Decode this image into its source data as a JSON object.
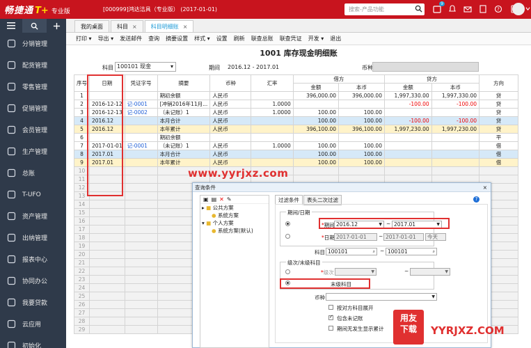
{
  "header": {
    "brand": "畅捷通",
    "brand_plus": "T+",
    "edition": "专业版",
    "company": "[000999]鸿达洁具（专业版） (2017-01-01)",
    "search_placeholder": "搜索-产品功能",
    "notification_count": "9"
  },
  "sidebar": {
    "items": [
      {
        "label": "分销管理",
        "icon": "distribution-icon"
      },
      {
        "label": "配货管理",
        "icon": "truck-icon"
      },
      {
        "label": "零售管理",
        "icon": "cart-icon"
      },
      {
        "label": "促销管理",
        "icon": "megaphone-icon"
      },
      {
        "label": "会员管理",
        "icon": "member-icon"
      },
      {
        "label": "生产管理",
        "icon": "gear-icon"
      },
      {
        "label": "总账",
        "icon": "ledger-icon"
      },
      {
        "label": "T-UFO",
        "icon": "report-icon"
      },
      {
        "label": "资产管理",
        "icon": "assets-icon"
      },
      {
        "label": "出纳管理",
        "icon": "cashier-icon"
      },
      {
        "label": "报表中心",
        "icon": "chart-icon"
      },
      {
        "label": "协同办公",
        "icon": "collab-icon"
      },
      {
        "label": "我要贷款",
        "icon": "loan-icon"
      },
      {
        "label": "云应用",
        "icon": "cloud-icon"
      },
      {
        "label": "初始化",
        "icon": "init-icon"
      }
    ]
  },
  "tabs": [
    {
      "label": "我的桌面",
      "closable": false,
      "active": false
    },
    {
      "label": "科目",
      "closable": true,
      "active": false
    },
    {
      "label": "科目明细账",
      "closable": true,
      "active": true
    }
  ],
  "toolbar": [
    "打印",
    "导出",
    "发送邮件",
    "查询",
    "摘要设置",
    "样式",
    "设置",
    "刷新",
    "联查总账",
    "联查凭证",
    "开发",
    "退出"
  ],
  "report": {
    "title": "1001  库存现金明细账",
    "subject_label": "科目",
    "subject_value": "100101 现金",
    "period_label": "期间",
    "period_value": "2016.12 - 2017.01",
    "currency_label": "币种"
  },
  "grid": {
    "headers": {
      "row_no": "序号",
      "date": "日期",
      "voucher": "凭证字号",
      "summary": "摘要",
      "currency": "币种",
      "rate": "汇率",
      "debit": "借方",
      "credit": "贷方",
      "direction": "方向",
      "amount": "金额",
      "base": "本币"
    },
    "rows": [
      {
        "no": "1",
        "date": "",
        "voucher": "",
        "summary": "期初余额",
        "currency": "人民币",
        "rate": "",
        "d_amt": "396,000.00",
        "d_base": "396,000.00",
        "c_amt": "1,997,330.00",
        "c_base": "1,997,330.00",
        "dir": "贷",
        "style": ""
      },
      {
        "no": "2",
        "date": "2016-12-12",
        "voucher": "记-0001",
        "summary": "[冲销2016年11月...",
        "currency": "人民币",
        "rate": "1.0000",
        "d_amt": "",
        "d_base": "",
        "c_amt": "-100.00",
        "c_base": "-100.00",
        "dir": "贷",
        "style": ""
      },
      {
        "no": "3",
        "date": "2016-12-13",
        "voucher": "记-0002",
        "summary": "（未记账）1",
        "currency": "人民币",
        "rate": "1.0000",
        "d_amt": "100.00",
        "d_base": "100.00",
        "c_amt": "",
        "c_base": "",
        "dir": "贷",
        "style": ""
      },
      {
        "no": "4",
        "date": "2016.12",
        "voucher": "",
        "summary": "本月合计",
        "currency": "人民币",
        "rate": "",
        "d_amt": "100.00",
        "d_base": "100.00",
        "c_amt": "-100.00",
        "c_base": "-100.00",
        "dir": "贷",
        "style": "blue-row"
      },
      {
        "no": "5",
        "date": "2016.12",
        "voucher": "",
        "summary": "本年累计",
        "currency": "人民币",
        "rate": "",
        "d_amt": "396,100.00",
        "d_base": "396,100.00",
        "c_amt": "1,997,230.00",
        "c_base": "1,997,230.00",
        "dir": "贷",
        "style": "yel-row"
      },
      {
        "no": "6",
        "date": "",
        "voucher": "",
        "summary": "期初余额",
        "currency": "",
        "rate": "",
        "d_amt": "",
        "d_base": "",
        "c_amt": "",
        "c_base": "",
        "dir": "平",
        "style": ""
      },
      {
        "no": "7",
        "date": "2017-01-01",
        "voucher": "记-0001",
        "summary": "（未记账）1",
        "currency": "人民币",
        "rate": "1.0000",
        "d_amt": "100.00",
        "d_base": "100.00",
        "c_amt": "",
        "c_base": "",
        "dir": "借",
        "style": ""
      },
      {
        "no": "8",
        "date": "2017.01",
        "voucher": "",
        "summary": "本月合计",
        "currency": "人民币",
        "rate": "",
        "d_amt": "100.00",
        "d_base": "100.00",
        "c_amt": "",
        "c_base": "",
        "dir": "借",
        "style": "blue-row"
      },
      {
        "no": "9",
        "date": "2017.01",
        "voucher": "",
        "summary": "本年累计",
        "currency": "人民币",
        "rate": "",
        "d_amt": "100.00",
        "d_base": "100.00",
        "c_amt": "",
        "c_base": "",
        "dir": "借",
        "style": "yel-row"
      },
      {
        "no": "10",
        "date": "",
        "voucher": "",
        "summary": "",
        "currency": "",
        "rate": "",
        "d_amt": "",
        "d_base": "",
        "c_amt": "",
        "c_base": "",
        "dir": "",
        "style": "gray-row"
      },
      {
        "no": "11",
        "date": "",
        "voucher": "",
        "summary": "",
        "currency": "",
        "rate": "",
        "d_amt": "",
        "d_base": "",
        "c_amt": "",
        "c_base": "",
        "dir": "",
        "style": "gray-row"
      },
      {
        "no": "12",
        "date": "",
        "voucher": "",
        "summary": "",
        "currency": "",
        "rate": "",
        "d_amt": "",
        "d_base": "",
        "c_amt": "",
        "c_base": "",
        "dir": "",
        "style": "gray-row"
      },
      {
        "no": "13",
        "date": "",
        "voucher": "",
        "summary": "",
        "currency": "",
        "rate": "",
        "d_amt": "",
        "d_base": "",
        "c_amt": "",
        "c_base": "",
        "dir": "",
        "style": "gray-row"
      },
      {
        "no": "14",
        "date": "",
        "voucher": "",
        "summary": "",
        "currency": "",
        "rate": "",
        "d_amt": "",
        "d_base": "",
        "c_amt": "",
        "c_base": "",
        "dir": "",
        "style": "gray-row"
      },
      {
        "no": "15",
        "date": "",
        "voucher": "",
        "summary": "",
        "currency": "",
        "rate": "",
        "d_amt": "",
        "d_base": "",
        "c_amt": "",
        "c_base": "",
        "dir": "",
        "style": "gray-row"
      },
      {
        "no": "16",
        "date": "",
        "voucher": "",
        "summary": "",
        "currency": "",
        "rate": "",
        "d_amt": "",
        "d_base": "",
        "c_amt": "",
        "c_base": "",
        "dir": "",
        "style": "gray-row"
      },
      {
        "no": "17",
        "date": "",
        "voucher": "",
        "summary": "",
        "currency": "",
        "rate": "",
        "d_amt": "",
        "d_base": "",
        "c_amt": "",
        "c_base": "",
        "dir": "",
        "style": "gray-row"
      },
      {
        "no": "18",
        "date": "",
        "voucher": "",
        "summary": "",
        "currency": "",
        "rate": "",
        "d_amt": "",
        "d_base": "",
        "c_amt": "",
        "c_base": "",
        "dir": "",
        "style": "gray-row"
      },
      {
        "no": "19",
        "date": "",
        "voucher": "",
        "summary": "",
        "currency": "",
        "rate": "",
        "d_amt": "",
        "d_base": "",
        "c_amt": "",
        "c_base": "",
        "dir": "",
        "style": "gray-row"
      },
      {
        "no": "20",
        "date": "",
        "voucher": "",
        "summary": "",
        "currency": "",
        "rate": "",
        "d_amt": "",
        "d_base": "",
        "c_amt": "",
        "c_base": "",
        "dir": "",
        "style": "gray-row"
      },
      {
        "no": "21",
        "date": "",
        "voucher": "",
        "summary": "",
        "currency": "",
        "rate": "",
        "d_amt": "",
        "d_base": "",
        "c_amt": "",
        "c_base": "",
        "dir": "",
        "style": "gray-row"
      },
      {
        "no": "22",
        "date": "",
        "voucher": "",
        "summary": "",
        "currency": "",
        "rate": "",
        "d_amt": "",
        "d_base": "",
        "c_amt": "",
        "c_base": "",
        "dir": "",
        "style": "gray-row"
      },
      {
        "no": "23",
        "date": "",
        "voucher": "",
        "summary": "",
        "currency": "",
        "rate": "",
        "d_amt": "",
        "d_base": "",
        "c_amt": "",
        "c_base": "",
        "dir": "",
        "style": "gray-row"
      },
      {
        "no": "24",
        "date": "",
        "voucher": "",
        "summary": "",
        "currency": "",
        "rate": "",
        "d_amt": "",
        "d_base": "",
        "c_amt": "",
        "c_base": "",
        "dir": "",
        "style": "gray-row"
      },
      {
        "no": "25",
        "date": "",
        "voucher": "",
        "summary": "",
        "currency": "",
        "rate": "",
        "d_amt": "",
        "d_base": "",
        "c_amt": "",
        "c_base": "",
        "dir": "",
        "style": "gray-row"
      },
      {
        "no": "26",
        "date": "",
        "voucher": "",
        "summary": "",
        "currency": "",
        "rate": "",
        "d_amt": "",
        "d_base": "",
        "c_amt": "",
        "c_base": "",
        "dir": "",
        "style": "gray-row"
      },
      {
        "no": "27",
        "date": "",
        "voucher": "",
        "summary": "",
        "currency": "",
        "rate": "",
        "d_amt": "",
        "d_base": "",
        "c_amt": "",
        "c_base": "",
        "dir": "",
        "style": "gray-row"
      },
      {
        "no": "28",
        "date": "",
        "voucher": "",
        "summary": "",
        "currency": "",
        "rate": "",
        "d_amt": "",
        "d_base": "",
        "c_amt": "",
        "c_base": "",
        "dir": "",
        "style": "gray-row"
      },
      {
        "no": "29",
        "date": "",
        "voucher": "",
        "summary": "",
        "currency": "",
        "rate": "",
        "d_amt": "",
        "d_base": "",
        "c_amt": "",
        "c_base": "",
        "dir": "",
        "style": "gray-row"
      }
    ]
  },
  "watermark": "www.yyrjxz.com",
  "dialog": {
    "title": "查询条件",
    "tree": [
      "公共方案",
      "系统方案",
      "个人方案",
      "系统方案(默认)"
    ],
    "tabs": [
      "过滤条件",
      "表头二次过滤"
    ],
    "period_group": "期间/日期",
    "period_label": "期间",
    "period_from": "2016.12",
    "period_to": "2017.01",
    "date_label": "日期",
    "date_from": "2017-01-01",
    "date_to": "2017-01-01",
    "date_today": "今天",
    "subject_label": "科目",
    "subject_from": "100101",
    "subject_to": "100101",
    "level_group": "级次/末级科目",
    "level_label": "级次",
    "leaf_label": "末级科目",
    "currency_label": "币种",
    "opt_expand": "按对方科目展开",
    "opt_include_unposted": "包含未记账",
    "opt_show_no_activity": "期间无发生显示累计",
    "tilde": "~"
  },
  "footer_watermark": {
    "box_line1": "用友",
    "box_line2": "下载",
    "site": "YYRJXZ.COM"
  }
}
